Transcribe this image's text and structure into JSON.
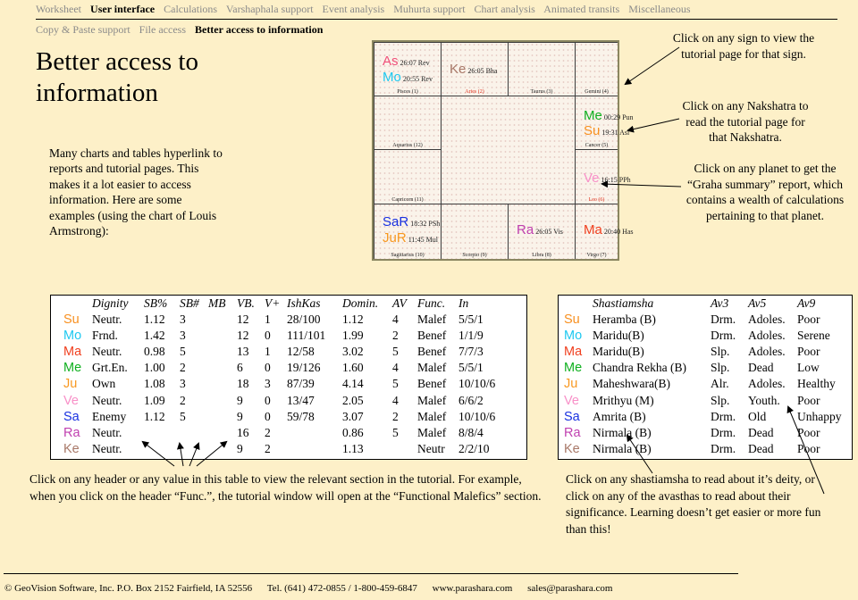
{
  "nav": {
    "primary": [
      {
        "label": "Worksheet",
        "active": false
      },
      {
        "label": "User interface",
        "active": true
      },
      {
        "label": "Calculations",
        "active": false
      },
      {
        "label": "Varshaphala support",
        "active": false
      },
      {
        "label": "Event analysis",
        "active": false
      },
      {
        "label": "Muhurta support",
        "active": false
      },
      {
        "label": "Chart analysis",
        "active": false
      },
      {
        "label": "Animated transits",
        "active": false
      },
      {
        "label": "Miscellaneous",
        "active": false
      }
    ],
    "secondary": [
      {
        "label": "Copy & Paste support",
        "active": false
      },
      {
        "label": "File access",
        "active": false
      },
      {
        "label": "Better access to information",
        "active": true
      }
    ]
  },
  "page_title": "Better access to information",
  "intro": "Many charts and tables hyperlink to reports and tutorial pages. This makes it a lot easier to access information. Here are some examples (using the chart of Louis Armstrong):",
  "chart": {
    "houses": {
      "pisces": {
        "label": "Pisces (1)",
        "planets": [
          {
            "abbr": "As",
            "deg": "26:07 Rev",
            "color": "#f0507a"
          },
          {
            "abbr": "Mo",
            "deg": "20:55 Rev",
            "color": "#1ec8f0"
          }
        ]
      },
      "aries": {
        "label": "Aries (2)",
        "planets": [
          {
            "abbr": "Ke",
            "deg": "26:05 Bha",
            "color": "#a87868"
          }
        ]
      },
      "taurus": {
        "label": "Taurus (3)",
        "planets": []
      },
      "gemini": {
        "label": "Gemini (4)",
        "planets": []
      },
      "aquarius": {
        "label": "Aquarius (12)",
        "planets": []
      },
      "cancer": {
        "label": "Cancer (5)",
        "planets": [
          {
            "abbr": "Me",
            "deg": "00:29 Pun",
            "color": "#10b020"
          },
          {
            "abbr": "Su",
            "deg": "19:31 Asl",
            "color": "#f89020"
          }
        ]
      },
      "capricorn": {
        "label": "Capricorn (11)",
        "planets": []
      },
      "leo": {
        "label": "Leo (6)",
        "planets": [
          {
            "abbr": "Ve",
            "deg": "16:15 PPh",
            "color": "#f890c8"
          }
        ]
      },
      "sagittarius": {
        "label": "Sagittarius (10)",
        "planets": [
          {
            "abbr": "SaR",
            "deg": "18:32 PSh",
            "color": "#1830e0"
          },
          {
            "abbr": "JuR",
            "deg": "11:45 Mul",
            "color": "#f89820"
          }
        ]
      },
      "scorpio": {
        "label": "Scorpio (9)",
        "planets": []
      },
      "libra": {
        "label": "Libra (8)",
        "planets": [
          {
            "abbr": "Ra",
            "deg": "26:05 Vis",
            "color": "#c040b0"
          }
        ]
      },
      "virgo": {
        "label": "Virgo (7)",
        "planets": [
          {
            "abbr": "Ma",
            "deg": "20:40 Has",
            "color": "#f04020"
          }
        ]
      }
    }
  },
  "notes": {
    "sign": "Click on any sign to view the tutorial page for that sign.",
    "nakshatra": "Click on any Nakshatra to read the tutorial page for that Nakshatra.",
    "planet": "Click on any planet to get the “Graha summary” report, which contains a wealth of calculations pertaining to that planet.",
    "table1": "Click on any header or any value in this table to view the relevant section in the tutorial. For example, when you click on the header “Func.”, the tutorial window will open at the “Functional Malefics” section.",
    "table2": "Click on any shastiamsha to read about it’s deity, or click on any of the avasthas to read about their significance. Learning doesn’t get easier or more fun than this!"
  },
  "table1": {
    "headers": [
      "",
      "Dignity",
      "SB%",
      "SB#",
      "MB",
      "VB.",
      "V+",
      "IshKas",
      "Domin.",
      "AV",
      "Func.",
      "In"
    ],
    "rows": [
      {
        "planet": "Su",
        "color": "#f89020",
        "cells": [
          "Neutr.",
          "1.12",
          "3",
          "",
          "12",
          "1",
          "28/100",
          "1.12",
          "4",
          "Malef",
          "5/5/1"
        ]
      },
      {
        "planet": "Mo",
        "color": "#1ec8f0",
        "cells": [
          "Frnd.",
          "1.42",
          "3",
          "",
          "12",
          "0",
          "111/101",
          "1.99",
          "2",
          "Benef",
          "1/1/9"
        ]
      },
      {
        "planet": "Ma",
        "color": "#f04020",
        "cells": [
          "Neutr.",
          "0.98",
          "5",
          "",
          "13",
          "1",
          "12/58",
          "3.02",
          "5",
          "Benef",
          "7/7/3"
        ]
      },
      {
        "planet": "Me",
        "color": "#10b020",
        "cells": [
          "Grt.En.",
          "1.00",
          "2",
          "",
          "6",
          "0",
          "19/126",
          "1.60",
          "4",
          "Malef",
          "5/5/1"
        ]
      },
      {
        "planet": "Ju",
        "color": "#f89820",
        "cells": [
          "Own",
          "1.08",
          "3",
          "",
          "18",
          "3",
          "87/39",
          "4.14",
          "5",
          "Benef",
          "10/10/6"
        ]
      },
      {
        "planet": "Ve",
        "color": "#f890c8",
        "cells": [
          "Neutr.",
          "1.09",
          "2",
          "",
          "9",
          "0",
          "13/47",
          "2.05",
          "4",
          "Malef",
          "6/6/2"
        ]
      },
      {
        "planet": "Sa",
        "color": "#1830e0",
        "cells": [
          "Enemy",
          "1.12",
          "5",
          "",
          "9",
          "0",
          "59/78",
          "3.07",
          "2",
          "Malef",
          "10/10/6"
        ]
      },
      {
        "planet": "Ra",
        "color": "#c040b0",
        "cells": [
          "Neutr.",
          "",
          "",
          "",
          "16",
          "2",
          "",
          "0.86",
          "5",
          "Malef",
          "8/8/4"
        ]
      },
      {
        "planet": "Ke",
        "color": "#a87868",
        "cells": [
          "Neutr.",
          "",
          "",
          "",
          "9",
          "2",
          "",
          "1.13",
          "",
          "Neutr",
          "2/2/10"
        ]
      }
    ]
  },
  "table2": {
    "headers": [
      "",
      "Shastiamsha",
      "Av3",
      "Av5",
      "Av9"
    ],
    "rows": [
      {
        "planet": "Su",
        "color": "#f89020",
        "cells": [
          "Heramba (B)",
          "Drm.",
          "Adoles.",
          "Poor"
        ]
      },
      {
        "planet": "Mo",
        "color": "#1ec8f0",
        "cells": [
          "Maridu(B)",
          "Drm.",
          "Adoles.",
          "Serene"
        ]
      },
      {
        "planet": "Ma",
        "color": "#f04020",
        "cells": [
          "Maridu(B)",
          "Slp.",
          "Adoles.",
          "Poor"
        ]
      },
      {
        "planet": "Me",
        "color": "#10b020",
        "cells": [
          "Chandra Rekha (B)",
          "Slp.",
          "Dead",
          "Low"
        ]
      },
      {
        "planet": "Ju",
        "color": "#f89820",
        "cells": [
          "Maheshwara(B)",
          "Alr.",
          "Adoles.",
          "Healthy"
        ]
      },
      {
        "planet": "Ve",
        "color": "#f890c8",
        "cells": [
          "Mrithyu (M)",
          "Slp.",
          "Youth.",
          "Poor"
        ]
      },
      {
        "planet": "Sa",
        "color": "#1830e0",
        "cells": [
          "Amrita (B)",
          "Drm.",
          "Old",
          "Unhappy"
        ]
      },
      {
        "planet": "Ra",
        "color": "#c040b0",
        "cells": [
          "Nirmala (B)",
          "Drm.",
          "Dead",
          "Poor"
        ]
      },
      {
        "planet": "Ke",
        "color": "#a87868",
        "cells": [
          "Nirmala (B)",
          "Drm.",
          "Dead",
          "Poor"
        ]
      }
    ]
  },
  "footer": {
    "company": "© GeoVision Software, Inc. P.O. Box 2152 Fairfield, IA 52556",
    "phone": "Tel. (641) 472-0855 / 1-800-459-6847",
    "website": "www.parashara.com",
    "email": "sales@parashara.com"
  }
}
